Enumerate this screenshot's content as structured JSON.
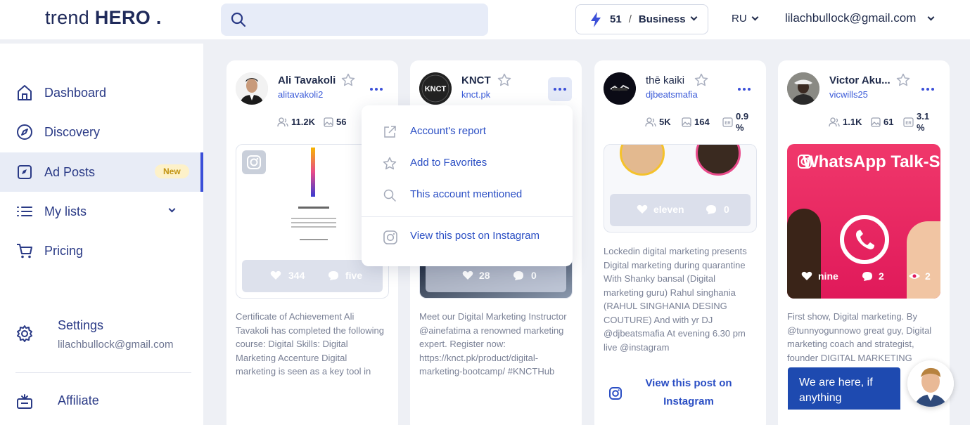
{
  "header": {
    "logo_light": "trend ",
    "logo_bold": "HERO",
    "logo_dot": " .",
    "credits": "51",
    "plan": "Business",
    "language": "RU",
    "email": "lilachbullock@gmail.com"
  },
  "sidebar": {
    "items": [
      {
        "label": "Dashboard",
        "icon": "home-icon"
      },
      {
        "label": "Discovery",
        "icon": "compass-icon"
      },
      {
        "label": "Ad Posts",
        "icon": "ad-posts-icon",
        "badge": "New"
      },
      {
        "label": "My lists",
        "icon": "list-icon"
      },
      {
        "label": "Pricing",
        "icon": "cart-icon"
      }
    ],
    "settings_label": "Settings",
    "settings_email": "lilachbullock@gmail.com",
    "affiliate_label": "Affiliate"
  },
  "cards": [
    {
      "name": "Ali Tavakoli",
      "handle": "alitavakoli2",
      "followers": "11.2K",
      "posts": "56",
      "likes": "344",
      "comments": "five",
      "description": "Certificate of Achievement Ali Tavakoli has completed the following course: Digital Skills: Digital Marketing Accenture Digital marketing is seen as a key tool in"
    },
    {
      "name": "KNCT",
      "handle": "knct.pk",
      "likes": "28",
      "comments": "0",
      "description": "Meet our Digital Marketing Instructor @ainefatima a renowned marketing expert. Register now: https://knct.pk/product/digital-marketing-bootcamp/ #KNCTHub"
    },
    {
      "name": "thē kaiki",
      "handle": "djbeatsmafia",
      "followers": "5K",
      "posts": "164",
      "er": "0.9\n%",
      "likes": "eleven",
      "comments": "0",
      "description": "Lockedin digital marketing presents Digital marketing during quarantine With Shanky bansal (Digital marketing guru) Rahul singhania (RAHUL SINGHANIA DESING COUTURE) And with yr DJ @djbeatsmafia At evening 6.30 pm live @instagram",
      "view_label": "View this post on Instagram"
    },
    {
      "name": "Victor Aku...",
      "handle": "vicwills25",
      "followers": "1.1K",
      "posts": "61",
      "er": "3.1\n%",
      "likes": "nine",
      "comments": "2",
      "views": "2",
      "media_text": "WhatsApp Talk-Sho",
      "description": "First show, Digital marketing. By @tunnyogunnowo great guy, Digital marketing coach and strategist, founder DIGITAL MARKETING"
    }
  ],
  "menu": {
    "items": [
      "Account's report",
      "Add to Favorites",
      "This account mentioned",
      "View this post on Instagram"
    ]
  },
  "chat": {
    "text": "We are here, if anything"
  },
  "colors": {
    "accent": "#3b4fd8",
    "link": "#2a4ec4",
    "nav_text": "#2a3a86",
    "chat": "#1e4ab0"
  }
}
